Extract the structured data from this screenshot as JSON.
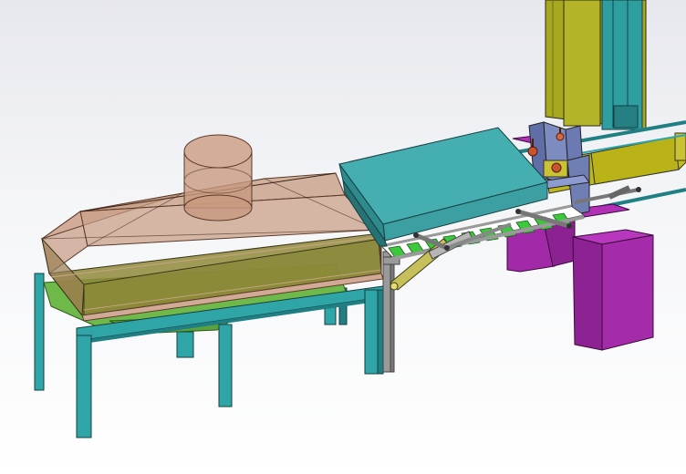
{
  "viewport": {
    "background_top": "#e7e8ee",
    "background_bottom": "#ffffff"
  },
  "colors": {
    "frame_teal": "#2fa5a8",
    "frame_teal_dark": "#1f7f82",
    "hood_copper": "#c89a80",
    "hood_olive": "#8a9a38",
    "oven_teal": "#3c9fa2",
    "oven_teal_top": "#45aeb0",
    "conveyor_green": "#3cc83c",
    "rail_gray": "#9a9a9a",
    "cabinet_magenta": "#a22aa8",
    "tower_olive": "#a7a820",
    "bracket_blue": "#6f7fb4",
    "cylinder_yellow": "#c7c05a",
    "valve_red": "#c9552f"
  },
  "components": [
    "main-frame",
    "exhaust-hood",
    "exhaust-duct",
    "heating-oven",
    "roller-conveyor",
    "pneumatic-cylinder",
    "magenta-cabinet",
    "olive-tower",
    "blue-bracket",
    "olive-trays"
  ]
}
